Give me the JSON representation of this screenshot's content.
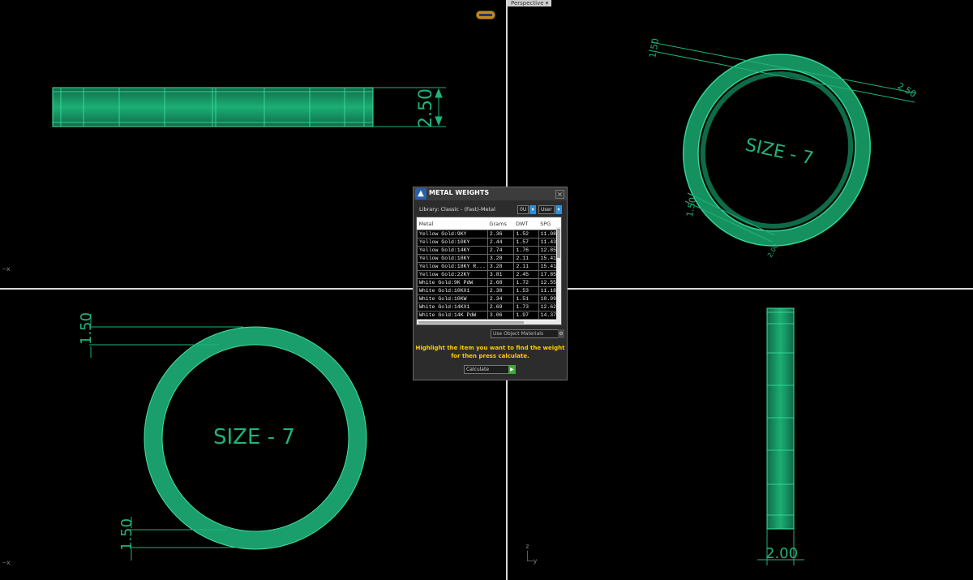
{
  "viewport": {
    "perspective_label": "Perspective",
    "dimensions": {
      "top_height": "2.50",
      "perspective_a": "1.50",
      "perspective_b": "2.50",
      "perspective_c": "1.50",
      "perspective_d": "2.00",
      "front_top": "1.50",
      "front_bottom": "1.50",
      "right_width": "2.00"
    },
    "size_label": "SIZE - 7",
    "axis_x": "x",
    "axis_z": "z",
    "axis_y": "y"
  },
  "dialog": {
    "title": "METAL WEIGHTS",
    "library": "Library: Classic - (Fast)-Metal",
    "unit_value": "0U",
    "user_label": "User",
    "columns": [
      "Metal",
      "Grams",
      "DWT",
      "SPG"
    ],
    "rows": [
      [
        "Yellow Gold:9KY",
        "2.36",
        "1.52",
        "11.08"
      ],
      [
        "Yellow Gold:10KY",
        "2.44",
        "1.57",
        "11.43"
      ],
      [
        "Yellow Gold:14KY",
        "2.74",
        "1.76",
        "12.85"
      ],
      [
        "Yellow Gold:18KY",
        "3.28",
        "2.11",
        "15.41"
      ],
      [
        "Yellow Gold:18KY R...",
        "3.28",
        "2.11",
        "15.41"
      ],
      [
        "Yellow Gold:22KY",
        "3.81",
        "2.45",
        "17.85"
      ],
      [
        "White Gold:9K PdW",
        "2.68",
        "1.72",
        "12.55"
      ],
      [
        "White Gold:10KX1",
        "2.38",
        "1.53",
        "11.18"
      ],
      [
        "White Gold:10KW",
        "2.34",
        "1.51",
        "10.99"
      ],
      [
        "White Gold:14KX1",
        "2.69",
        "1.73",
        "12.62"
      ],
      [
        "White Gold:14K PdW",
        "3.06",
        "1.97",
        "14.37"
      ]
    ],
    "object_materials": "Use Object Materials",
    "hint_line1": "Highlight the item you want to find the weight",
    "hint_line2": "for then press calculate.",
    "calculate_label": "Calculate"
  },
  "colors": {
    "ring": "#1a9e6b",
    "ring_light": "#3ad79a",
    "dimension": "#1fb37a",
    "background": "#000000",
    "hint": "#ffcc00"
  }
}
